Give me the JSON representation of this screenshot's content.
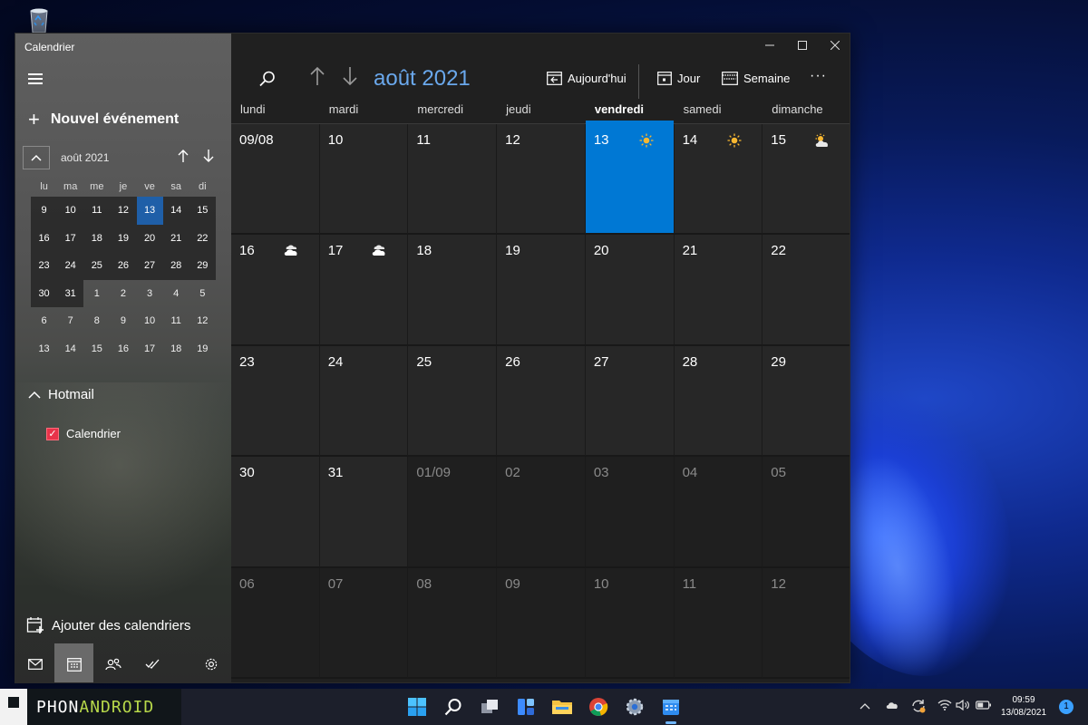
{
  "app": {
    "title": "Calendrier"
  },
  "sidebar": {
    "new_event_label": "Nouvel événement",
    "mini_calendar": {
      "title": "août 2021",
      "weekdays": [
        "lu",
        "ma",
        "me",
        "je",
        "ve",
        "sa",
        "di"
      ],
      "weeks": [
        [
          "9",
          "10",
          "11",
          "12",
          "13",
          "14",
          "15"
        ],
        [
          "16",
          "17",
          "18",
          "19",
          "20",
          "21",
          "22"
        ],
        [
          "23",
          "24",
          "25",
          "26",
          "27",
          "28",
          "29"
        ],
        [
          "30",
          "31",
          "1",
          "2",
          "3",
          "4",
          "5"
        ],
        [
          "6",
          "7",
          "8",
          "9",
          "10",
          "11",
          "12"
        ],
        [
          "13",
          "14",
          "15",
          "16",
          "17",
          "18",
          "19"
        ]
      ],
      "selected": "13"
    },
    "account_label": "Hotmail",
    "calendar_item_label": "Calendrier",
    "add_calendars_label": "Ajouter des calendriers"
  },
  "toolbar": {
    "title": "août 2021",
    "today_label": "Aujourd'hui",
    "day_label": "Jour",
    "week_label": "Semaine"
  },
  "month_view": {
    "weekdays": [
      "lundi",
      "mardi",
      "mercredi",
      "jeudi",
      "vendredi",
      "samedi",
      "dimanche"
    ],
    "today_weekday_index": 4,
    "weeks": [
      [
        "09/08",
        "10",
        "11",
        "12",
        "13",
        "14",
        "15"
      ],
      [
        "16",
        "17",
        "18",
        "19",
        "20",
        "21",
        "22"
      ],
      [
        "23",
        "24",
        "25",
        "26",
        "27",
        "28",
        "29"
      ],
      [
        "30",
        "31",
        "01/09",
        "02",
        "03",
        "04",
        "05"
      ],
      [
        "06",
        "07",
        "08",
        "09",
        "10",
        "11",
        "12"
      ]
    ],
    "weather": {
      "0-4": "sun-icon",
      "0-5": "sun-icon",
      "0-6": "partly-sunny-icon",
      "1-0": "cloudy-icon",
      "1-1": "cloudy-icon"
    }
  },
  "taskbar": {
    "brand_prefix": "PHON",
    "brand_highlight": "ANDROID",
    "time": "09:59",
    "date": "13/08/2021",
    "notifications": "1"
  },
  "colors": {
    "accent": "#0078d4",
    "toolbar_title": "#6aa8ec",
    "checkbox": "#e8334a"
  }
}
